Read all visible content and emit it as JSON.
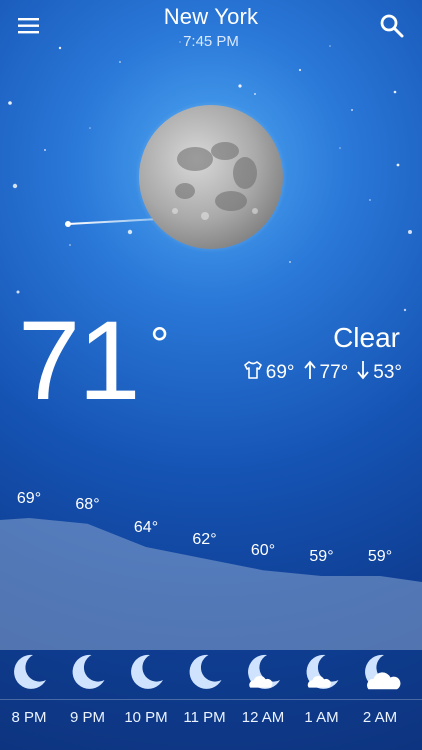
{
  "header": {
    "city": "New York",
    "time": "7:45 PM"
  },
  "current": {
    "temperature": "71",
    "degree_symbol": "°",
    "condition": "Clear",
    "feels_like": "69°",
    "high": "77°",
    "low": "53°"
  },
  "hourly": [
    {
      "time": "8 PM",
      "temp": "69°",
      "temp_value": 69,
      "icon": "moon-icon"
    },
    {
      "time": "9 PM",
      "temp": "68°",
      "temp_value": 68,
      "icon": "moon-icon"
    },
    {
      "time": "10 PM",
      "temp": "64°",
      "temp_value": 64,
      "icon": "moon-icon"
    },
    {
      "time": "11 PM",
      "temp": "62°",
      "temp_value": 62,
      "icon": "moon-icon"
    },
    {
      "time": "12 AM",
      "temp": "60°",
      "temp_value": 60,
      "icon": "moon-cloud-icon"
    },
    {
      "time": "1 AM",
      "temp": "59°",
      "temp_value": 59,
      "icon": "moon-cloud-icon"
    },
    {
      "time": "2 AM",
      "temp": "59°",
      "temp_value": 59,
      "icon": "moon-cloud-icon"
    }
  ],
  "colors": {
    "moon_icon": "#cfe3ff",
    "graph_fill": "#8aa6cf"
  }
}
